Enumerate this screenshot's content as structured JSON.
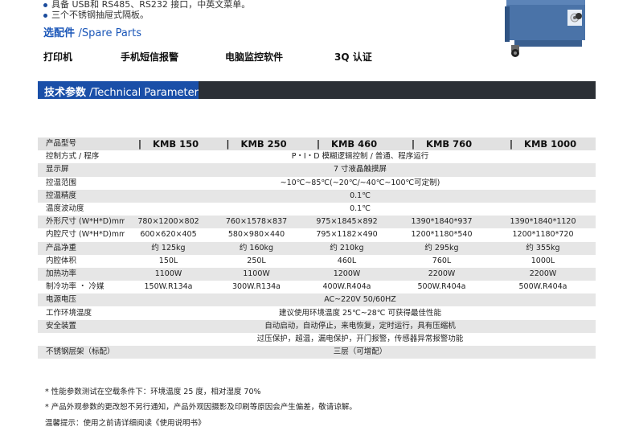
{
  "features": {
    "line1": "具备 USB和 RS485、RS232 接口，中英文菜单。",
    "line2": "三个不锈钢抽屉式隔板。"
  },
  "spare_parts": {
    "title_cn": "选配件",
    "title_en": "/Spare Parts",
    "items": [
      "打印机",
      "手机短信报警",
      "电脑监控软件",
      "3Q 认证"
    ]
  },
  "section": {
    "title_cn": "技术参数",
    "title_en": " /Technical Parameter"
  },
  "spec": {
    "header_label": "产品型号",
    "separator": "|",
    "models": [
      "KMB 150",
      "KMB 250",
      "KMB 460",
      "KMB 760",
      "KMB 1000"
    ],
    "rows": [
      {
        "label": "控制方式 / 程序",
        "span": "P・I・D 模糊逻辑控制 / 普通、程序运行"
      },
      {
        "label": "显示屏",
        "span": "7 寸液晶触摸屏"
      },
      {
        "label": "控温范围",
        "span": "~10℃~85℃(~20℃/~40℃~100℃可定制)"
      },
      {
        "label": "控温精度",
        "span": "0.1℃"
      },
      {
        "label": "温度波动度",
        "span": "0.1℃"
      },
      {
        "label": "外形尺寸 (W*H*D)mm",
        "values": [
          "780×1200×802",
          "760×1578×837",
          "975×1845×892",
          "1390*1840*937",
          "1390*1840*1120"
        ]
      },
      {
        "label": "内腔尺寸 (W*H*D)mm",
        "values": [
          "600×620×405",
          "580×980×440",
          "795×1182×490",
          "1200*1180*540",
          "1200*1180*720"
        ]
      },
      {
        "label": "产品净重",
        "values": [
          "约 125kg",
          "约 160kg",
          "约 210kg",
          "约 295kg",
          "约 355kg"
        ]
      },
      {
        "label": "内腔体积",
        "values": [
          "150L",
          "250L",
          "460L",
          "760L",
          "1000L"
        ]
      },
      {
        "label": "加热功率",
        "values": [
          "1100W",
          "1100W",
          "1200W",
          "2200W",
          "2200W"
        ]
      },
      {
        "label": "制冷功率 ・ 冷媒",
        "values": [
          "150W.R134a",
          "300W.R134a",
          "400W.R404a",
          "500W.R404a",
          "500W.R404a"
        ]
      },
      {
        "label": "电源电压",
        "span": "AC~220V 50/60HZ"
      },
      {
        "label": "工作环境温度",
        "span": "建议使用环境温度 25℃~28℃ 可获得最佳性能"
      },
      {
        "label": "安全装置",
        "span": "自动启动，自动停止，来电恢复，定时运行，具有压缩机"
      },
      {
        "label": "",
        "span": "过压保护，超温，漏电保护，开门报警，传感器异常报警功能"
      },
      {
        "label": "不锈钢层架（标配）",
        "span": "三层（可增配）"
      }
    ]
  },
  "notes": [
    "* 性能参数测试在空载条件下：环境温度 25 度，相对湿度 70%",
    "* 产品外观参数的更改恕不另行通知，产品外观因摄影及印刷等原因会产生偏差，敬请谅解。",
    "温馨提示：使用之前请详细阅读《使用说明书》"
  ]
}
